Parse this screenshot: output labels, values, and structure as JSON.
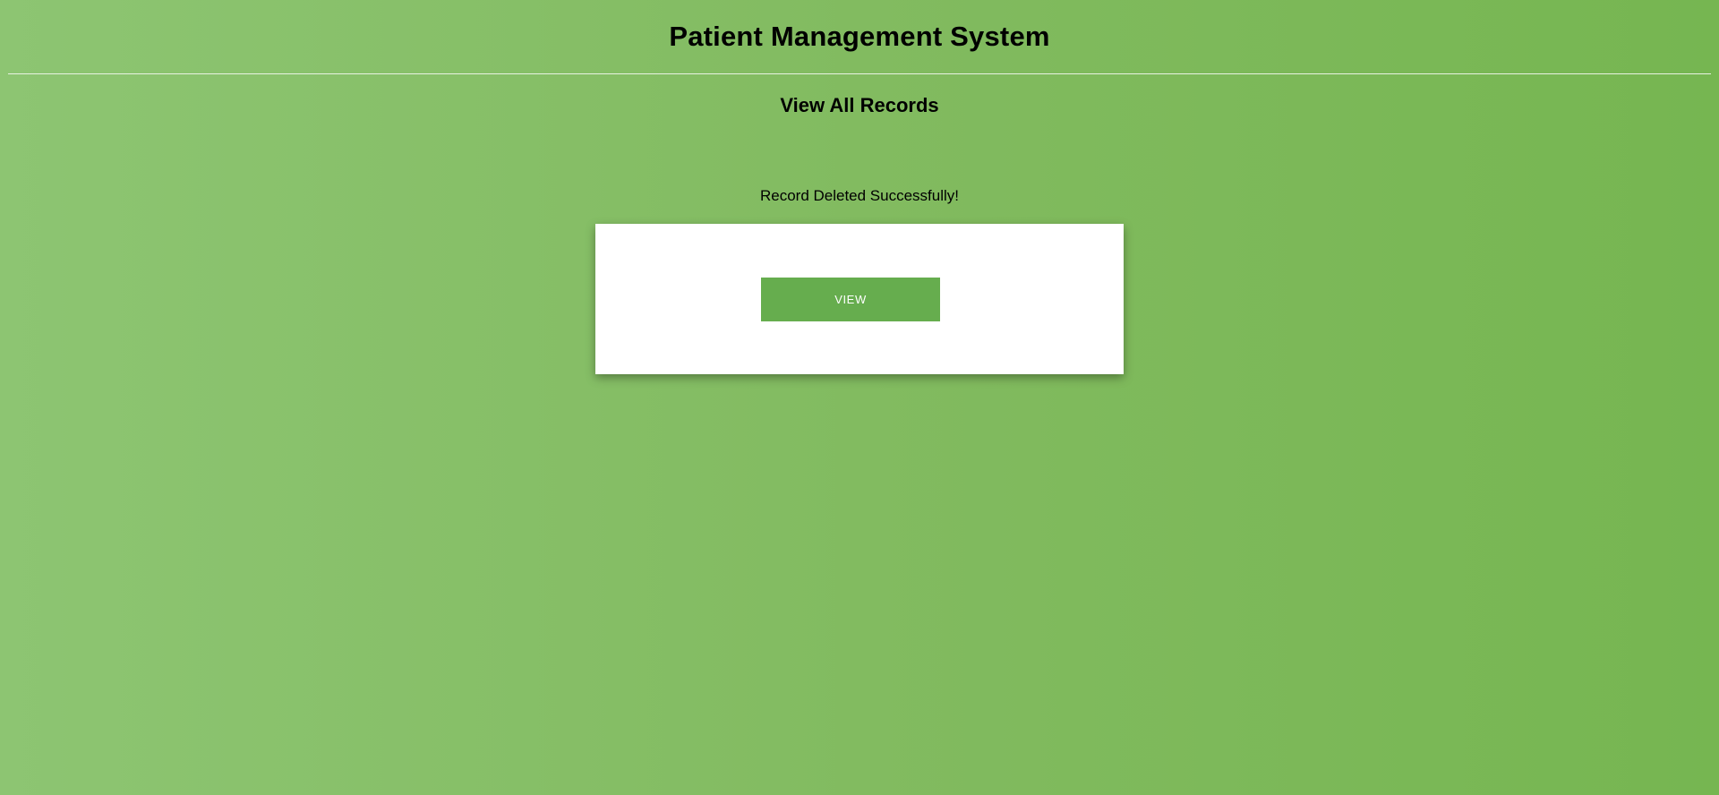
{
  "header": {
    "title": "Patient Management System"
  },
  "main": {
    "page_title": "View All Records",
    "status_message": "Record Deleted Successfully!",
    "card": {
      "view_button_label": "VIEW"
    }
  },
  "colors": {
    "background_start": "#8dc572",
    "background_end": "#76b651",
    "button": "#66ad4e",
    "card": "#ffffff"
  }
}
